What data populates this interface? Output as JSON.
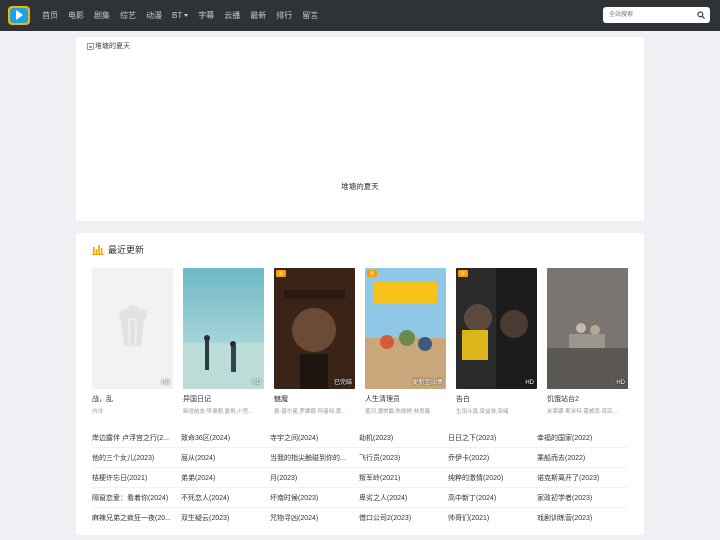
{
  "nav": {
    "items": [
      "首页",
      "电影",
      "剧集",
      "综艺",
      "动漫",
      "BT",
      "字幕",
      "云播",
      "最新",
      "排行",
      "留言"
    ],
    "search_placeholder": "全站搜索"
  },
  "banner": {
    "image_alt": "堆塘的夏天",
    "caption": "堆塘的夏天"
  },
  "latest": {
    "title": "最近更新",
    "cards": [
      {
        "title": "战，乱",
        "cast": "内详",
        "badge": "HD",
        "tag": ""
      },
      {
        "title": "异国日记",
        "cast": "新垣结衣,早濑憩,夏帆,小宫...",
        "badge": "HD",
        "tag": ""
      },
      {
        "title": "魅魔",
        "cast": "爵·普尔曼,罗娜娜·阿曼特,黄...",
        "badge": "已完结",
        "tag": "荐"
      },
      {
        "title": "人生清理员",
        "cast": "黄河,潘崇馥,陈婉婷,林意箴",
        "badge": "更新至09集",
        "tag": "荐"
      },
      {
        "title": "告白",
        "cast": "生田斗真,梁益准,奈绪",
        "badge": "HD",
        "tag": "荐"
      },
      {
        "title": "饥饿站台2",
        "cast": "米莱娜·斯米特,霍威克·库匹...",
        "badge": "HD",
        "tag": ""
      }
    ],
    "links": [
      [
        "岸边露伴 卢浮宫之行(2...",
        "致命36区(2024)",
        "寺宇之间(2024)",
        "劫机(2023)",
        "日日之下(2023)",
        "幸福的国家(2022)"
      ],
      [
        "他的三个女儿(2023)",
        "屈从(2024)",
        "当我的指尖触碰到你的...",
        "飞行员(2023)",
        "乔伊卡(2022)",
        "乘船而去(2022)"
      ],
      [
        "桔梗许忘日(2021)",
        "弟弟(2024)",
        "月(2023)",
        "叛军岭(2021)",
        "纯粹的激情(2020)",
        "诺克斯离开了(2023)"
      ],
      [
        "隔窗恋爱：看着你(2024)",
        "不死恋人(2024)",
        "坏南时候(2023)",
        "卑劣之人(2024)",
        "高中新丁(2024)",
        "家政初学者(2023)"
      ],
      [
        "麻辣兄弟之疯狂一夜(20...",
        "双生疑云(2023)",
        "咒物寻凶(2024)",
        "借口公司2(2023)",
        "帅哥们(2021)",
        "戏剧训练营(2023)"
      ]
    ]
  },
  "colors": {
    "navbar": "#2f3236",
    "accent": "#f5a000",
    "logo_blue": "#1aa3e8"
  }
}
